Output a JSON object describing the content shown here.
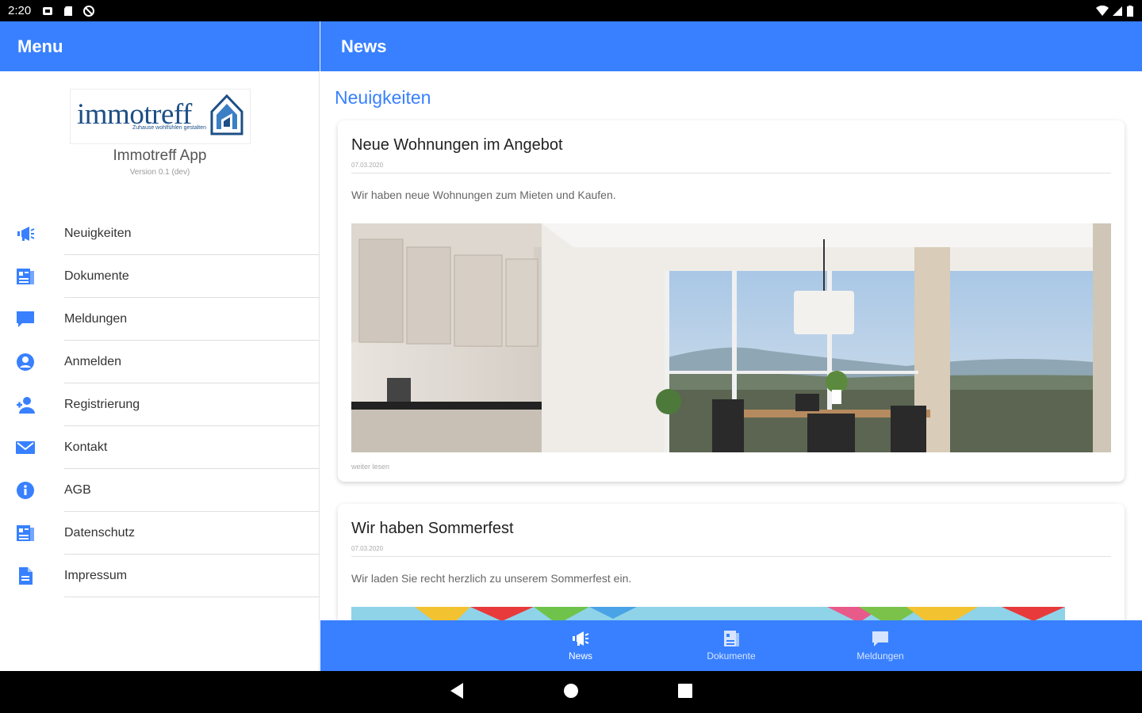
{
  "status_bar": {
    "time": "2:20"
  },
  "left_header": {
    "title": "Menu"
  },
  "right_header": {
    "title": "News"
  },
  "side_menu": {
    "logo_text": "immotreff",
    "logo_tagline": "Zuhause wohlfühlen gestalten",
    "app_name": "Immotreff App",
    "app_version": "Version 0.1 (dev)",
    "items": [
      {
        "label": "Neuigkeiten",
        "icon": "megaphone-icon"
      },
      {
        "label": "Dokumente",
        "icon": "document-icon"
      },
      {
        "label": "Meldungen",
        "icon": "chat-icon"
      },
      {
        "label": "Anmelden",
        "icon": "person-circle-icon"
      },
      {
        "label": "Registrierung",
        "icon": "person-add-icon"
      },
      {
        "label": "Kontakt",
        "icon": "mail-icon"
      },
      {
        "label": "AGB",
        "icon": "info-icon"
      },
      {
        "label": "Datenschutz",
        "icon": "document-icon"
      },
      {
        "label": "Impressum",
        "icon": "file-icon"
      }
    ]
  },
  "content": {
    "section_title": "Neuigkeiten",
    "cards": [
      {
        "title": "Neue Wohnungen im Angebot",
        "date": "07.03.2020",
        "text": "Wir haben neue Wohnungen zum Mieten und Kaufen.",
        "more": "weiter lesen"
      },
      {
        "title": "Wir haben Sommerfest",
        "date": "07.03.2020",
        "text": "Wir laden Sie recht herzlich zu unserem Sommerfest ein."
      }
    ]
  },
  "tabbar": {
    "tabs": [
      {
        "label": "News",
        "active": true
      },
      {
        "label": "Dokumente",
        "active": false
      },
      {
        "label": "Meldungen",
        "active": false
      }
    ]
  },
  "colors": {
    "primary": "#3880ff",
    "logo_blue": "#1d4f86"
  }
}
